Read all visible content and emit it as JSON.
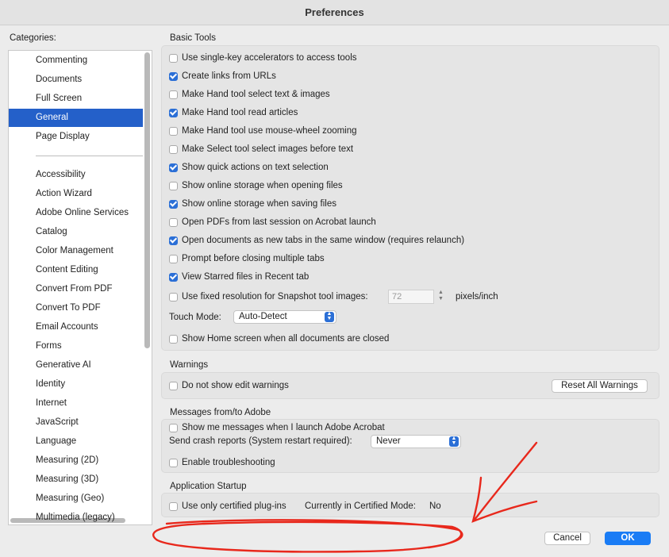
{
  "window": {
    "title": "Preferences"
  },
  "sidebar": {
    "label": "Categories:",
    "items": [
      "Commenting",
      "Documents",
      "Full Screen",
      "General",
      "Page Display",
      "Accessibility",
      "Action Wizard",
      "Adobe Online Services",
      "Catalog",
      "Color Management",
      "Content Editing",
      "Convert From PDF",
      "Convert To PDF",
      "Email Accounts",
      "Forms",
      "Generative AI",
      "Identity",
      "Internet",
      "JavaScript",
      "Language",
      "Measuring (2D)",
      "Measuring (3D)",
      "Measuring (Geo)",
      "Multimedia (legacy)"
    ],
    "selected": "General"
  },
  "basic_tools": {
    "title": "Basic Tools",
    "options": [
      {
        "label": "Use single-key accelerators to access tools",
        "checked": false
      },
      {
        "label": "Create links from URLs",
        "checked": true
      },
      {
        "label": "Make Hand tool select text & images",
        "checked": false
      },
      {
        "label": "Make Hand tool read articles",
        "checked": true
      },
      {
        "label": "Make Hand tool use mouse-wheel zooming",
        "checked": false
      },
      {
        "label": "Make Select tool select images before text",
        "checked": false
      },
      {
        "label": "Show quick actions on text selection",
        "checked": true
      },
      {
        "label": "Show online storage when opening files",
        "checked": false
      },
      {
        "label": "Show online storage when saving files",
        "checked": true
      },
      {
        "label": "Open PDFs from last session on Acrobat launch",
        "checked": false
      },
      {
        "label": "Open documents as new tabs in the same window (requires relaunch)",
        "checked": true
      },
      {
        "label": "Prompt before closing multiple tabs",
        "checked": false
      },
      {
        "label": "View Starred files in Recent tab",
        "checked": true
      }
    ],
    "snapshot": {
      "label": "Use fixed resolution for Snapshot tool images:",
      "checked": false,
      "value": "72",
      "unit": "pixels/inch"
    },
    "touch_mode": {
      "label": "Touch Mode:",
      "value": "Auto-Detect"
    },
    "home_screen": {
      "label": "Show Home screen when all documents are closed",
      "checked": false
    }
  },
  "warnings": {
    "title": "Warnings",
    "no_edit": {
      "label": "Do not show edit warnings",
      "checked": false
    },
    "reset_button": "Reset All Warnings"
  },
  "messages": {
    "title": "Messages from/to Adobe",
    "show_messages": {
      "label": "Show me messages when I launch Adobe Acrobat",
      "checked": false
    },
    "crash": {
      "label": "Send crash reports (System restart required):",
      "value": "Never"
    },
    "troubleshoot": {
      "label": "Enable troubleshooting",
      "checked": false
    }
  },
  "startup": {
    "title": "Application Startup",
    "certified": {
      "label": "Use only certified plug-ins",
      "checked": false
    },
    "mode_label": "Currently in Certified Mode:",
    "mode_value": "No"
  },
  "footer": {
    "cancel": "Cancel",
    "ok": "OK"
  },
  "colors": {
    "accent": "#2b6fd6",
    "selection": "#2460c9",
    "annotation": "#e8281c"
  }
}
